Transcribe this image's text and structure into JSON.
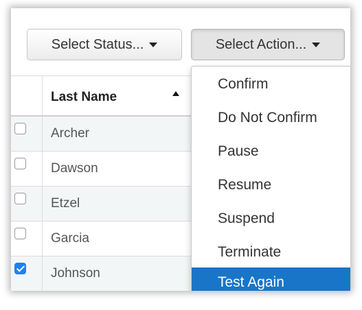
{
  "toolbar": {
    "status_label": "Select Status...",
    "action_label": "Select Action..."
  },
  "grid": {
    "header_last_name": "Last Name",
    "rows": [
      {
        "last_name": "Archer",
        "checked": false
      },
      {
        "last_name": "Dawson",
        "checked": false
      },
      {
        "last_name": "Etzel",
        "checked": false
      },
      {
        "last_name": "Garcia",
        "checked": false
      },
      {
        "last_name": "Johnson",
        "checked": true
      }
    ]
  },
  "action_menu": {
    "items": [
      "Confirm",
      "Do Not Confirm",
      "Pause",
      "Resume",
      "Suspend",
      "Terminate",
      "Test Again"
    ],
    "highlighted": "Test Again"
  },
  "colors": {
    "highlight": "#1975c7",
    "checkbox_checked": "#1a82f7"
  },
  "icons": {
    "sort": "sort-ascending-icon",
    "caret": "caret-down-icon",
    "check": "checkmark-icon"
  }
}
